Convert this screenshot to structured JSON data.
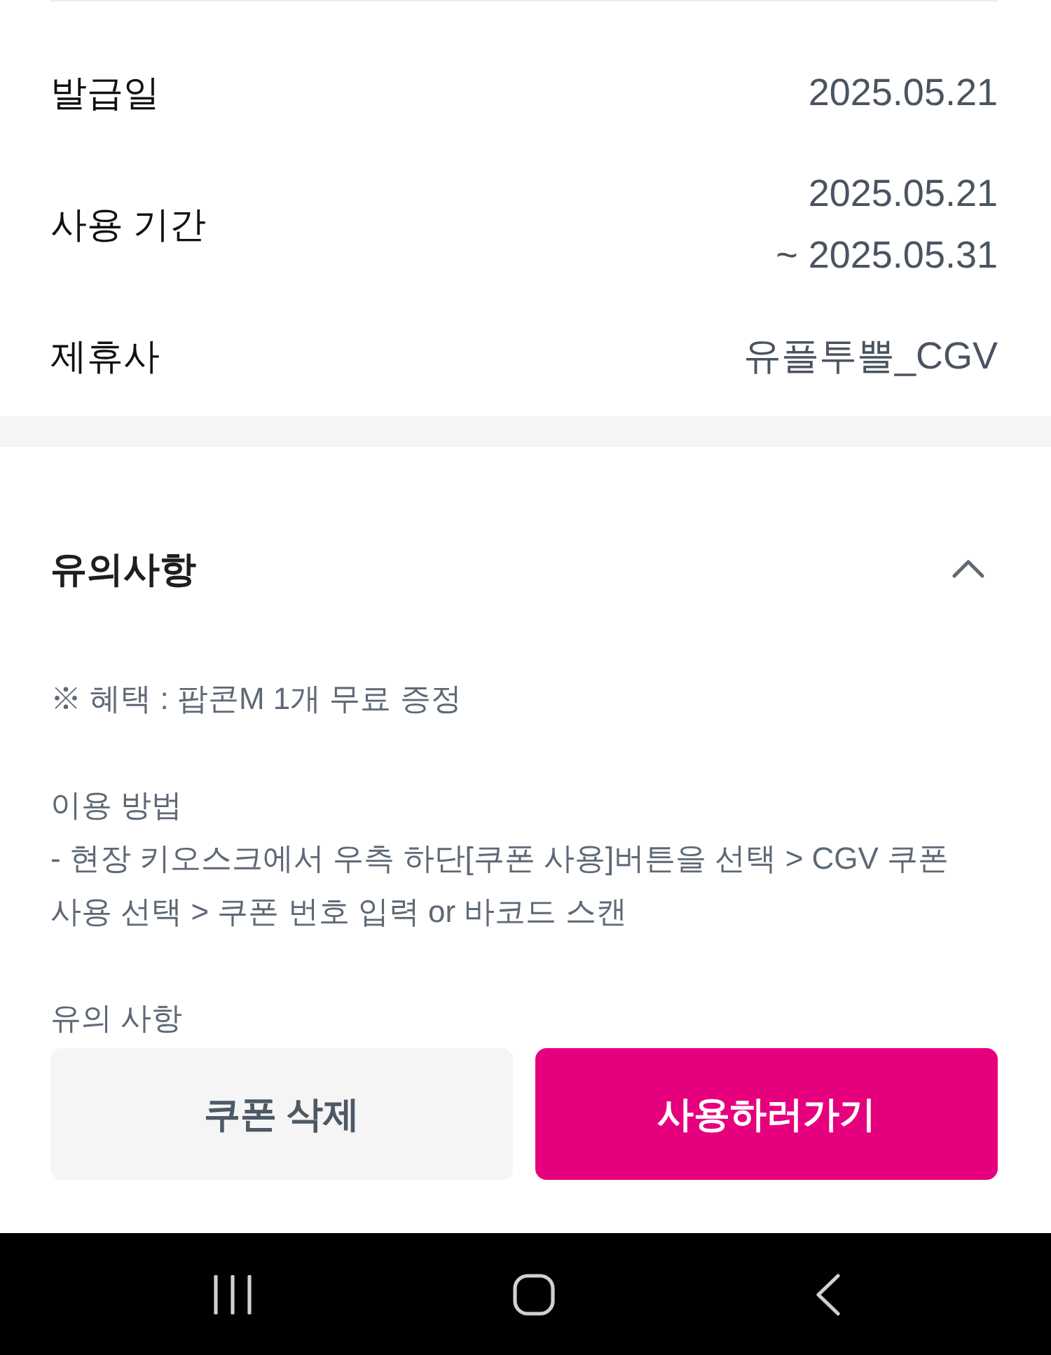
{
  "details": [
    {
      "label": "발급일",
      "value_lines": [
        "2025.05.21"
      ]
    },
    {
      "label": "사용 기간",
      "value_lines": [
        "2025.05.21",
        "~ 2025.05.31"
      ]
    },
    {
      "label": "제휴사",
      "value_lines": [
        "유플투쁠_CGV"
      ]
    }
  ],
  "notice": {
    "title": "유의사항",
    "expanded": true,
    "sections": [
      {
        "lines": [
          "※ 혜택 : 팝콘M 1개 무료 증정"
        ]
      },
      {
        "lines": [
          "이용 방법",
          "- 현장 키오스크에서 우측 하단[쿠폰 사용]버튼을 선택 > CGV 쿠폰 사용 선택 > 쿠폰 번호 입력 or 바코드 스캔"
        ]
      },
      {
        "lines": [
          "유의 사항"
        ]
      }
    ]
  },
  "buttons": [
    {
      "label": "쿠폰 삭제",
      "kind": "secondary"
    },
    {
      "label": "사용하러가기",
      "kind": "primary"
    }
  ]
}
